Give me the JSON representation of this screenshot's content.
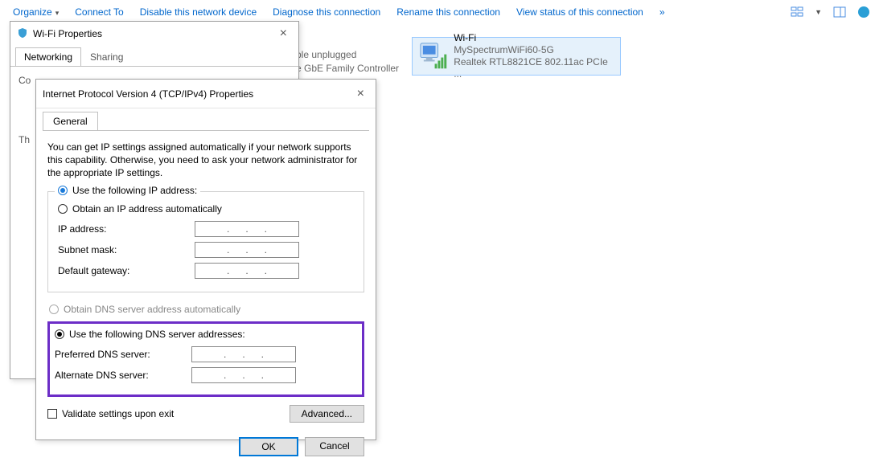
{
  "toolbar": {
    "items": [
      "Organize",
      "Connect To",
      "Disable this network device",
      "Diagnose this connection",
      "Rename this connection",
      "View status of this connection",
      "»"
    ]
  },
  "bgFragment": {
    "line1": "ble unplugged",
    "line2": "e GbE Family Controller"
  },
  "netItem": {
    "name": "Wi-Fi",
    "ssid": "MySpectrumWiFi60-5G",
    "adapter": "Realtek RTL8821CE 802.11ac PCIe ..."
  },
  "wifiProps": {
    "title": "Wi-Fi Properties",
    "tabs": [
      "Networking",
      "Sharing"
    ],
    "body": {
      "co": "Co",
      "th": "Th"
    }
  },
  "ipv4": {
    "title": "Internet Protocol Version 4 (TCP/IPv4) Properties",
    "tab": "General",
    "desc": "You can get IP settings assigned automatically if your network supports this capability. Otherwise, you need to ask your network administrator for the appropriate IP settings.",
    "ipGroup": {
      "auto": "Obtain an IP address automatically",
      "manual": "Use the following IP address:",
      "ip": "IP address:",
      "mask": "Subnet mask:",
      "gw": "Default gateway:"
    },
    "dnsGroup": {
      "auto": "Obtain DNS server address automatically",
      "manual": "Use the following DNS server addresses:",
      "pref": "Preferred DNS server:",
      "alt": "Alternate DNS server:"
    },
    "validate": "Validate settings upon exit",
    "advanced": "Advanced...",
    "ok": "OK",
    "cancel": "Cancel"
  }
}
